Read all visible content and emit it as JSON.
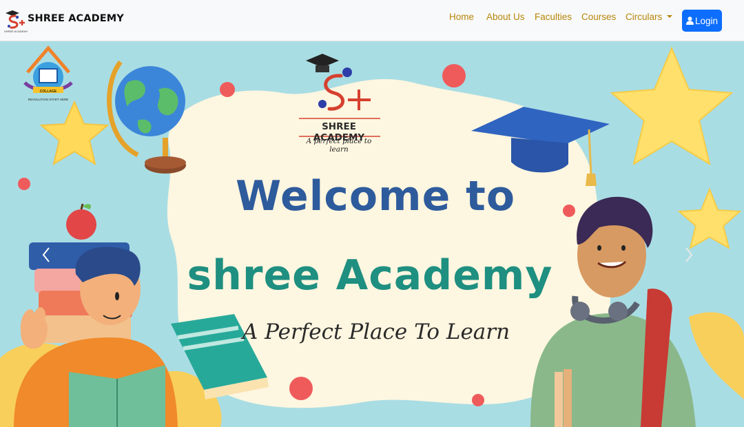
{
  "brand": {
    "name": "SHREE ACADEMY",
    "small_text": "SHREE ACADEMY"
  },
  "nav": {
    "items": [
      {
        "label": "Home"
      },
      {
        "label": "About Us"
      },
      {
        "label": "Faculties"
      },
      {
        "label": "Courses"
      },
      {
        "label": "Circulars",
        "has_dropdown": true
      }
    ],
    "login_label": "Login"
  },
  "hero": {
    "logo_name": "SHREE ACADEMY",
    "logo_tagline": "A perfect place to learn",
    "title_line_1": "Welcome to",
    "title_line_2": "shree Academy",
    "tagline": "A Perfect Place To Learn",
    "badge_label": "COLLAGE",
    "badge_sub": "REVOLUTION START HERE"
  },
  "colors": {
    "nav_link": "#b7860b",
    "login_button": "#0d6efd",
    "hero_background": "#a9dde4",
    "title_blue": "#2e5b9c",
    "title_teal": "#1e8f80"
  },
  "icons": {
    "login": "user-icon",
    "prev": "chevron-left-icon",
    "next": "chevron-right-icon",
    "dropdown": "caret-down-icon"
  }
}
